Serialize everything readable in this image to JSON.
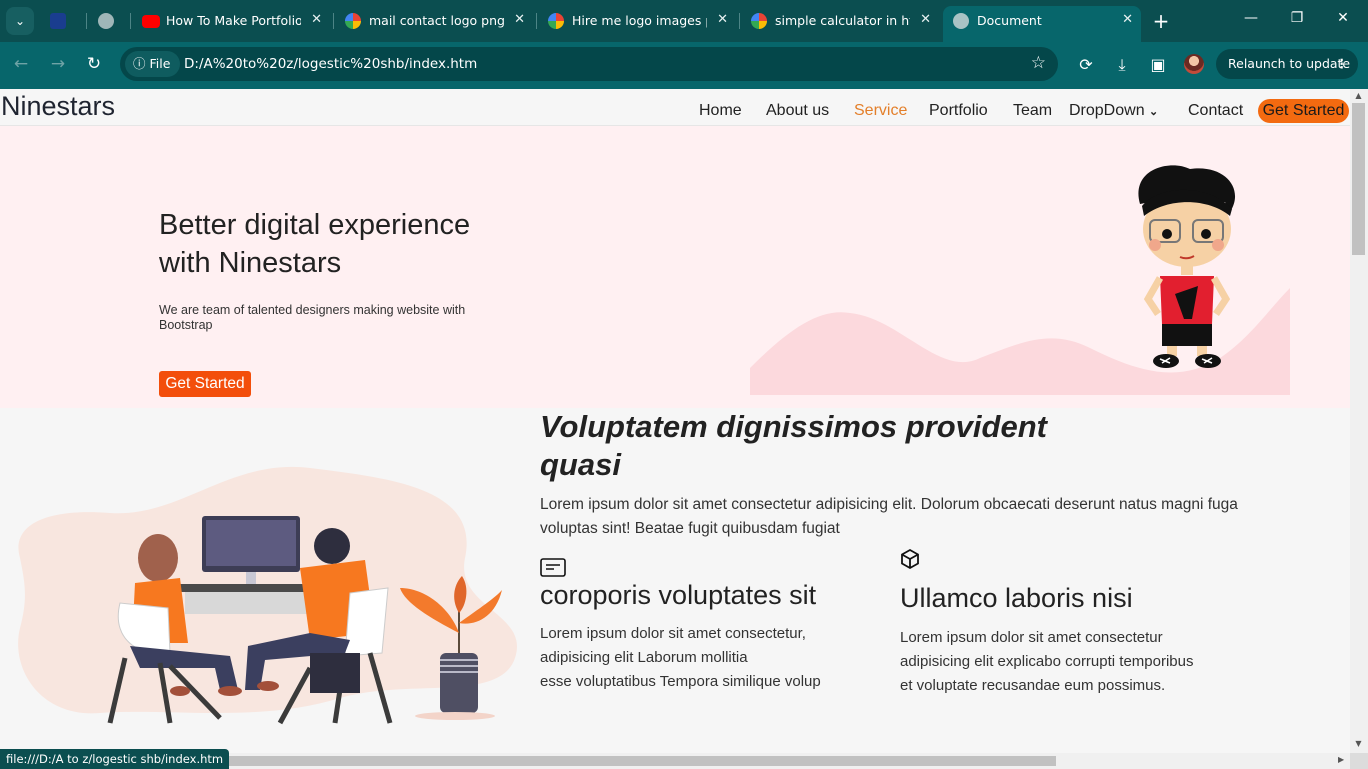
{
  "browser": {
    "tabs": [
      {
        "title": "",
        "icon": "app-icon"
      },
      {
        "title": "",
        "icon": "globe-icon"
      },
      {
        "title": "How To Make Portfolio W",
        "icon": "youtube-icon"
      },
      {
        "title": "mail contact logo png - G",
        "icon": "google-icon"
      },
      {
        "title": "Hire me logo images png",
        "icon": "google-icon"
      },
      {
        "title": "simple calculator in html",
        "icon": "google-icon"
      },
      {
        "title": "Document",
        "icon": "globe-icon",
        "active": true
      }
    ],
    "address_chip": "File",
    "url": "D:/A%20to%20z/logestic%20shb/index.htm",
    "relaunch_label": "Relaunch to update",
    "status_url": "file:///D:/A to z/logestic shb/index.htm",
    "colors": {
      "tab_strip": "#0b4e50",
      "toolbar": "#07666b"
    }
  },
  "site": {
    "logo": "Ninestars",
    "nav": [
      "Home",
      "About us",
      "Service",
      "Portfolio",
      "Team",
      "DropDown",
      "Contact"
    ],
    "nav_active": "Service",
    "nav_cta": "Get Started",
    "hero": {
      "title": "Better digital experience with Ninestars",
      "subtitle": "We are team of talented designers making website with Bootstrap",
      "button": "Get Started"
    },
    "about": {
      "title": "Voluptatem dignissimos provident quasi",
      "lead": "Lorem ipsum dolor sit amet consectetur adipisicing elit. Dolorum obcaecati deserunt natus magni fuga voluptas sint! Beatae fugit quibusdam fugiat",
      "features": [
        {
          "icon": "card-text-icon",
          "title": "coroporis voluptates sit",
          "text": "Lorem ipsum dolor sit amet consectetur,\nadipisicing elit Laborum mollitia\nesse voluptatibus Tempora similique volup"
        },
        {
          "icon": "box-icon",
          "title": "Ullamco laboris nisi",
          "text": "Lorem ipsum dolor sit amet consectetur\nadipisicing elit explicabo corrupti temporibus\net voluptate recusandae eum possimus."
        }
      ]
    },
    "colors": {
      "accent": "#f34e0b",
      "hero_bg": "#fff0f2",
      "nav_active": "#e37f2a"
    }
  }
}
